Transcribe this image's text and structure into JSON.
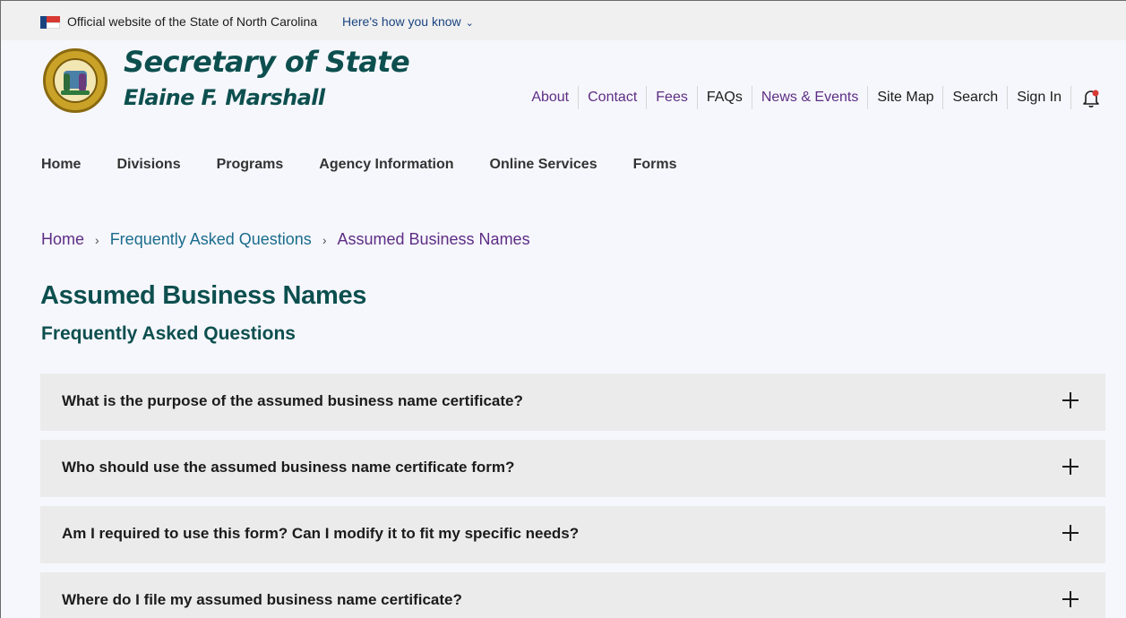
{
  "gov_banner": {
    "official_text": "Official website of the State of North Carolina",
    "how_you_know": "Here's how you know"
  },
  "header": {
    "title": "Secretary of State",
    "subtitle": "Elaine F. Marshall",
    "utility_nav": [
      {
        "label": "About"
      },
      {
        "label": "Contact"
      },
      {
        "label": "Fees"
      },
      {
        "label": "FAQs"
      },
      {
        "label": "News & Events"
      },
      {
        "label": "Site Map"
      },
      {
        "label": "Search"
      },
      {
        "label": "Sign In"
      }
    ]
  },
  "main_nav": [
    {
      "label": "Home"
    },
    {
      "label": "Divisions"
    },
    {
      "label": "Programs"
    },
    {
      "label": "Agency Information"
    },
    {
      "label": "Online Services"
    },
    {
      "label": "Forms"
    }
  ],
  "breadcrumb": {
    "items": [
      {
        "label": "Home"
      },
      {
        "label": "Frequently Asked Questions"
      }
    ],
    "current": "Assumed Business Names"
  },
  "page": {
    "title": "Assumed Business Names",
    "subtitle": "Frequently Asked Questions"
  },
  "faq": [
    {
      "question": "What is the purpose of the assumed business name certificate?"
    },
    {
      "question": "Who should use the assumed business name certificate form?"
    },
    {
      "question": "Am I required to use this form? Can I modify it to fit my specific needs?"
    },
    {
      "question": "Where do I file my assumed business name certificate?"
    }
  ],
  "colors": {
    "title_teal": "#0d4f4f",
    "link_purple": "#5e2d84",
    "link_blue": "#1a4480",
    "accordion_bg": "#ebebeb",
    "banner_bg": "#f0f0f0",
    "bell_dot": "#d83933"
  },
  "icons": {
    "flag": "us-flag-icon",
    "chevron": "chevron-down-icon",
    "bell": "bell-notification-icon",
    "expand": "plus-icon",
    "breadcrumb_separator": "chevron-right-icon"
  }
}
